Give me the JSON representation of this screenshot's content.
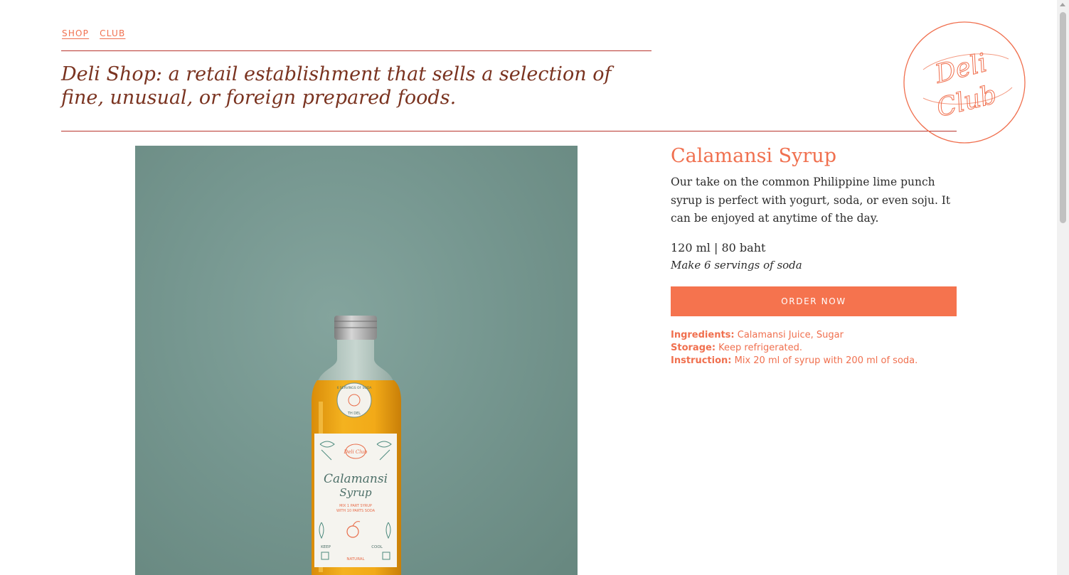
{
  "nav": {
    "items": [
      {
        "label": "SHOP"
      },
      {
        "label": "CLUB"
      }
    ]
  },
  "header": {
    "tagline": "Deli Shop: a retail establishment that sells a selection of fine, unusual, or foreign prepared foods.",
    "logo_text_1": "Deli",
    "logo_text_2": "Club"
  },
  "product": {
    "title": "Calamansi Syrup",
    "description": "Our take on the common Philippine lime punch syrup is perfect with yogurt, soda, or even soju. It can be enjoyed at anytime of the day.",
    "price": "120 ml | 80 baht",
    "servings": "Make 6 servings of soda",
    "order_label": "ORDER NOW",
    "specs": [
      {
        "label": "Ingredients:",
        "value": " Calamansi Juice, Sugar"
      },
      {
        "label": "Storage:",
        "value": " Keep refrigerated."
      },
      {
        "label": "Instruction:",
        "value": " Mix 20 ml of syrup with 200 ml of soda."
      }
    ],
    "bottle_label": {
      "brand": "Deli Club",
      "name_line_1": "Calamansi",
      "name_line_2": "Syrup",
      "directions_1": "MIX 1 PART SYRUP",
      "directions_2": "WITH 10 PARTS SODA",
      "keep": "KEEP",
      "cool": "COOL",
      "natural": "NATURAL",
      "seal_text": "6 SERVINGS OF SODA",
      "seal_sub": "TH DEL"
    }
  },
  "colors": {
    "accent": "#f0704f",
    "button": "#f5734e",
    "rule": "#b8352e",
    "tagline": "#7a3320",
    "image_bg": "#769790",
    "syrup": "#f0a81a"
  }
}
